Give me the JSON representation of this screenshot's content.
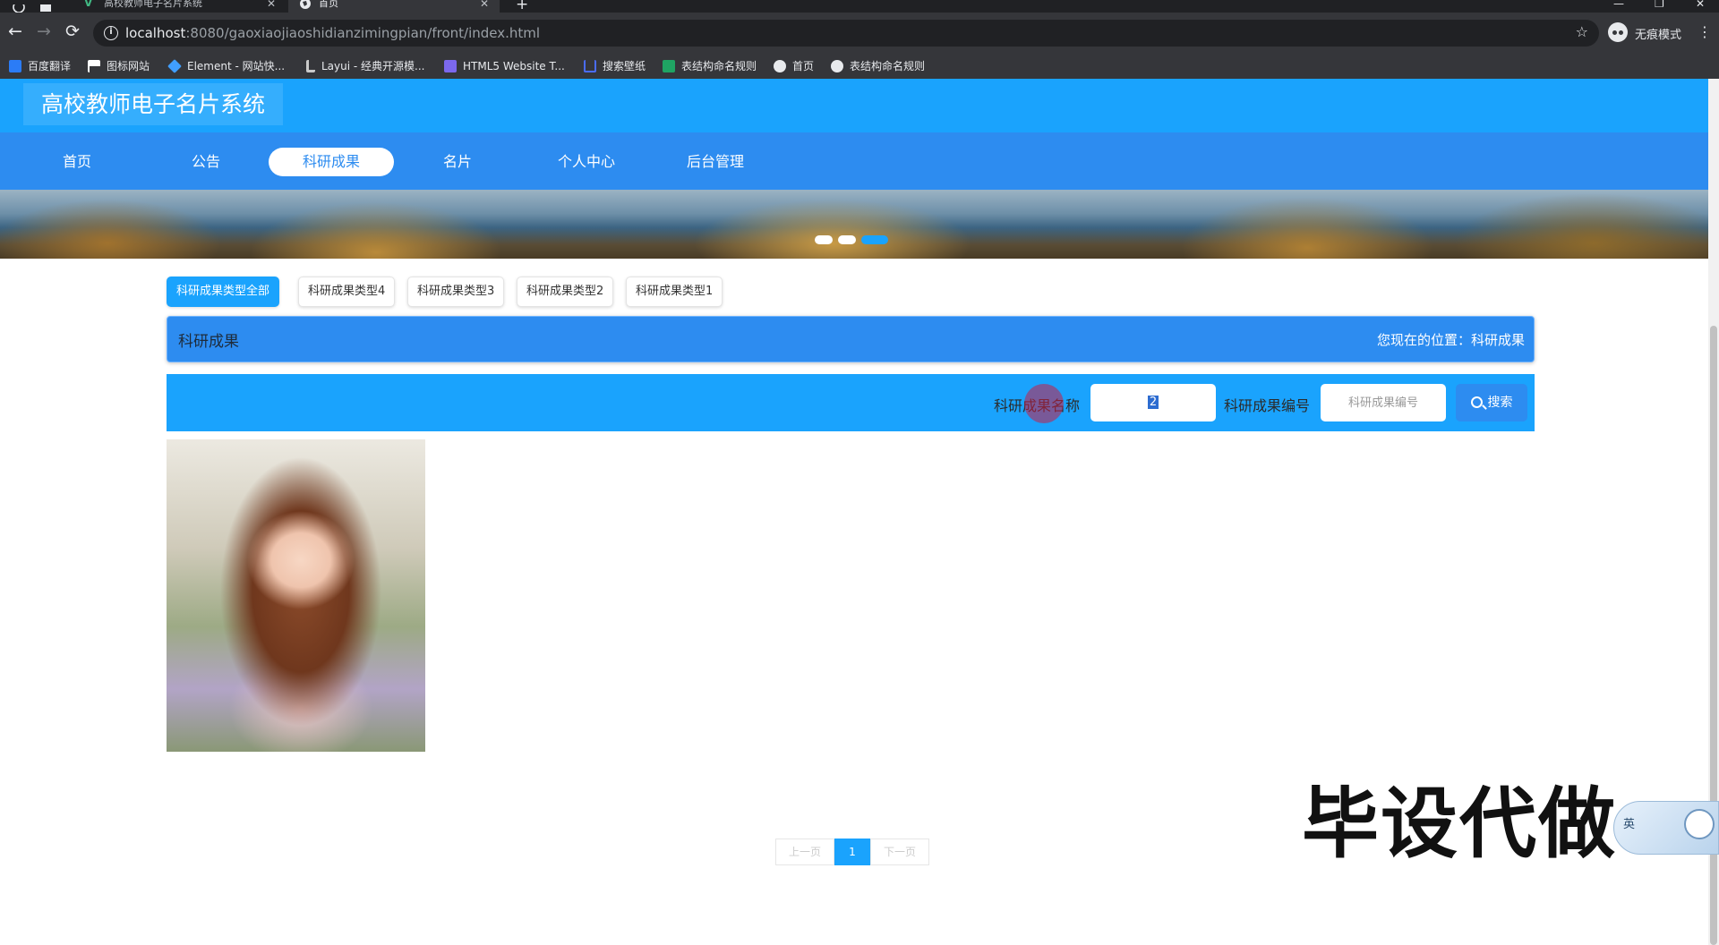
{
  "browser": {
    "tabs": [
      {
        "title": "高校教师电子名片系统",
        "active": false
      },
      {
        "title": "首页",
        "active": true
      }
    ],
    "new_tab": "+",
    "address": {
      "host": "localhost",
      "path": ":8080/gaoxiaojiaoshidianzimingpian/front/index.html"
    },
    "incognito_label": "无痕模式",
    "bookmarks": [
      {
        "label": "百度翻译",
        "icon": "translate-icon",
        "color": "#2b7cf6"
      },
      {
        "label": "图标网站",
        "icon": "flag-icon",
        "color": "#ffffff"
      },
      {
        "label": "Element - 网站快...",
        "icon": "element-icon",
        "color": "#409eff"
      },
      {
        "label": "Layui - 经典开源模...",
        "icon": "layui-icon",
        "color": "#c9c9c9"
      },
      {
        "label": "HTML5 Website T...",
        "icon": "html5-icon",
        "color": "#7b68ee"
      },
      {
        "label": "搜索壁纸",
        "icon": "wallpaper-icon",
        "color": "#4a6cf7"
      },
      {
        "label": "表结构命名规则",
        "icon": "sheet-icon",
        "color": "#1fa463"
      },
      {
        "label": "首页",
        "icon": "globe-icon",
        "color": "#e8eaed"
      },
      {
        "label": "表结构命名规则",
        "icon": "globe-icon",
        "color": "#e8eaed"
      }
    ]
  },
  "site": {
    "title": "高校教师电子名片系统",
    "nav": [
      {
        "label": "首页",
        "active": false
      },
      {
        "label": "公告",
        "active": false
      },
      {
        "label": "科研成果",
        "active": true
      },
      {
        "label": "名片",
        "active": false
      },
      {
        "label": "个人中心",
        "active": false
      },
      {
        "label": "后台管理",
        "active": false
      }
    ],
    "banner_slides": 3,
    "banner_active_slide": 3
  },
  "types": [
    {
      "label": "科研成果类型全部",
      "active": true
    },
    {
      "label": "科研成果类型4",
      "active": false
    },
    {
      "label": "科研成果类型3",
      "active": false
    },
    {
      "label": "科研成果类型2",
      "active": false
    },
    {
      "label": "科研成果类型1",
      "active": false
    }
  ],
  "section": {
    "title": "科研成果",
    "breadcrumb": "您现在的位置：科研成果"
  },
  "search": {
    "name_label": "科研成果名称",
    "name_value": "2",
    "code_label": "科研成果编号",
    "code_placeholder": "科研成果编号",
    "button_label": "搜索"
  },
  "pagination": {
    "prev": "上一页",
    "current": "1",
    "next": "下一页"
  },
  "overlay": {
    "watermark": "毕设代做",
    "ime_label": "英"
  },
  "colors": {
    "header": "#1aa3fd",
    "nav": "#2d8cf0",
    "accent": "#1aa3fd"
  }
}
